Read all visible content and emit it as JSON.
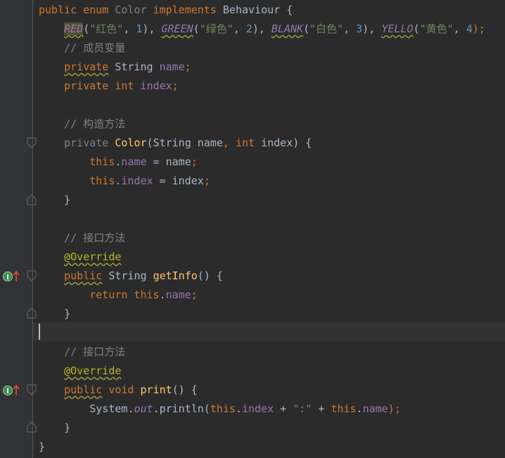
{
  "editor": {
    "lines": [
      [
        [
          "kw",
          "public "
        ],
        [
          "kw",
          "enum "
        ],
        [
          "unused",
          "Color "
        ],
        [
          "kw",
          "implements "
        ],
        [
          "cls",
          "Behaviour "
        ],
        [
          "",
          "{"
        ]
      ],
      [
        [
          "",
          "    "
        ],
        [
          "efld wavy sel-bg",
          "RED"
        ],
        [
          "",
          "("
        ],
        [
          "str",
          "\"红色\""
        ],
        [
          "",
          ", "
        ],
        [
          "num",
          "1"
        ],
        [
          "",
          "), "
        ],
        [
          "efld wavy",
          "GREEN"
        ],
        [
          "",
          "("
        ],
        [
          "str",
          "\"绿色\""
        ],
        [
          "",
          ", "
        ],
        [
          "num",
          "2"
        ],
        [
          "",
          "), "
        ],
        [
          "efld wavy",
          "BLANK"
        ],
        [
          "",
          "("
        ],
        [
          "str",
          "\"白色\""
        ],
        [
          "",
          ", "
        ],
        [
          "num",
          "3"
        ],
        [
          "",
          "), "
        ],
        [
          "efld wavy",
          "YELLO"
        ],
        [
          "",
          "("
        ],
        [
          "str",
          "\"黄色\""
        ],
        [
          "",
          ", "
        ],
        [
          "num",
          "4"
        ],
        [
          "kw",
          ");"
        ]
      ],
      [
        [
          "",
          "    "
        ],
        [
          "cmt",
          "// 成员变量"
        ]
      ],
      [
        [
          "",
          "    "
        ],
        [
          "kw wavy",
          "private"
        ],
        [
          "kw",
          " "
        ],
        [
          "cls",
          "String "
        ],
        [
          "fld",
          "name"
        ],
        [
          "kw",
          ";"
        ]
      ],
      [
        [
          "",
          "    "
        ],
        [
          "kw",
          "private "
        ],
        [
          "kw",
          "int "
        ],
        [
          "fld",
          "index"
        ],
        [
          "kw",
          ";"
        ]
      ],
      [
        [
          "",
          ""
        ]
      ],
      [
        [
          "",
          "    "
        ],
        [
          "cmt",
          "// 构造方法"
        ]
      ],
      [
        [
          "",
          "    "
        ],
        [
          "unused",
          "private "
        ],
        [
          "fn",
          "Color"
        ],
        [
          "",
          "("
        ],
        [
          "cls",
          "String "
        ],
        [
          "",
          "name"
        ],
        [
          "kw",
          ", "
        ],
        [
          "kw",
          "int "
        ],
        [
          "",
          "index) {"
        ]
      ],
      [
        [
          "",
          "        "
        ],
        [
          "kw",
          "this"
        ],
        [
          "",
          "."
        ],
        [
          "fld",
          "name"
        ],
        [
          "",
          " = name"
        ],
        [
          "kw",
          ";"
        ]
      ],
      [
        [
          "",
          "        "
        ],
        [
          "kw",
          "this"
        ],
        [
          "",
          "."
        ],
        [
          "fld",
          "index"
        ],
        [
          "",
          " = index"
        ],
        [
          "kw",
          ";"
        ]
      ],
      [
        [
          "",
          "    }"
        ]
      ],
      [
        [
          "",
          ""
        ]
      ],
      [
        [
          "",
          "    "
        ],
        [
          "cmt",
          "// 接口方法"
        ]
      ],
      [
        [
          "",
          "    "
        ],
        [
          "ann wavy",
          "@Override"
        ]
      ],
      [
        [
          "",
          "    "
        ],
        [
          "kw wavy",
          "public"
        ],
        [
          "kw",
          " "
        ],
        [
          "cls",
          "String "
        ],
        [
          "fn",
          "getInfo"
        ],
        [
          "",
          "() {"
        ]
      ],
      [
        [
          "",
          "        "
        ],
        [
          "kw",
          "return "
        ],
        [
          "kw",
          "this"
        ],
        [
          "",
          "."
        ],
        [
          "fld",
          "name"
        ],
        [
          "kw",
          ";"
        ]
      ],
      [
        [
          "",
          "    }"
        ]
      ],
      [
        [
          "",
          ""
        ]
      ],
      [
        [
          "",
          "    "
        ],
        [
          "cmt",
          "// 接口方法"
        ]
      ],
      [
        [
          "",
          "    "
        ],
        [
          "ann wavy",
          "@Override"
        ]
      ],
      [
        [
          "",
          "    "
        ],
        [
          "kw wavy",
          "public"
        ],
        [
          "kw",
          " "
        ],
        [
          "kw",
          "void "
        ],
        [
          "fn",
          "print"
        ],
        [
          "",
          "() {"
        ]
      ],
      [
        [
          "",
          "        "
        ],
        [
          "cls",
          "System"
        ],
        [
          "",
          "."
        ],
        [
          "efld",
          "out"
        ],
        [
          "",
          ".println("
        ],
        [
          "kw",
          "this"
        ],
        [
          "",
          "."
        ],
        [
          "fld",
          "index"
        ],
        [
          "",
          " + "
        ],
        [
          "str",
          "\":\""
        ],
        [
          "",
          " + "
        ],
        [
          "kw",
          "this"
        ],
        [
          "",
          "."
        ],
        [
          "fld",
          "name"
        ],
        [
          "kw",
          ");"
        ]
      ],
      [
        [
          "",
          "    }"
        ]
      ],
      [
        [
          "",
          "}"
        ]
      ]
    ]
  },
  "gutter": {
    "fold_icons": [
      "fold-start-icon",
      "fold-end-icon",
      "fold-start-icon",
      "fold-end-icon",
      "fold-start-icon",
      "fold-end-icon"
    ],
    "markers": [
      "implements-method-icon",
      "implements-method-icon"
    ]
  }
}
